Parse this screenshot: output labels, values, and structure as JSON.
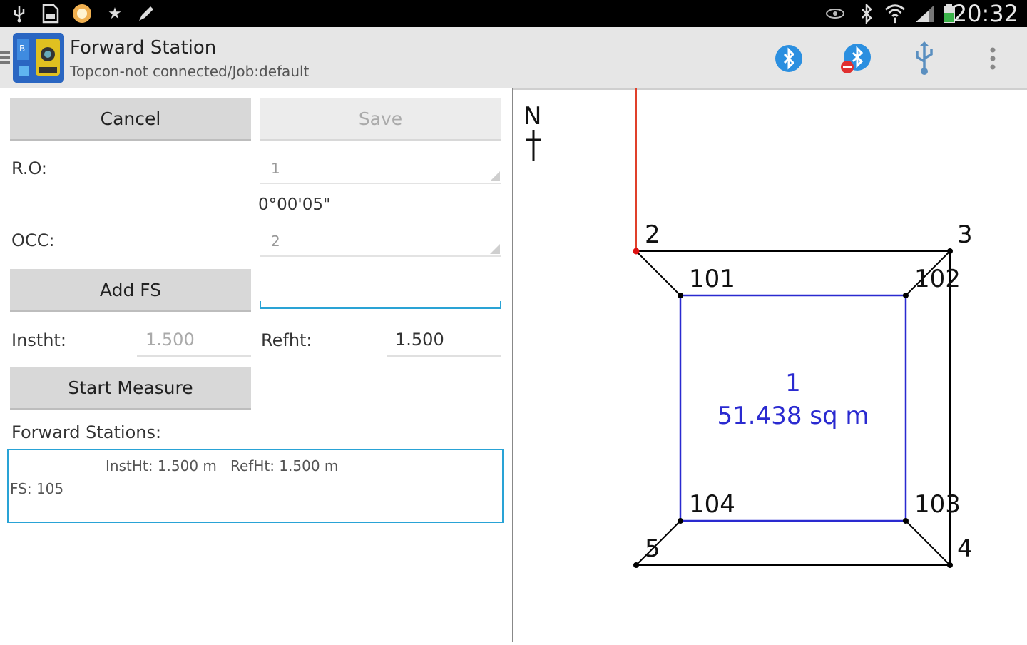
{
  "status_bar": {
    "time": "20:32",
    "left_icons": [
      "usb-icon",
      "sd-card-icon",
      "app-notification-icon",
      "star-icon",
      "pencil-icon"
    ],
    "right_icons": [
      "eye-icon",
      "bluetooth-icon",
      "wifi-icon",
      "signal-icon",
      "battery-icon"
    ]
  },
  "action_bar": {
    "title": "Forward Station",
    "subtitle": "Topcon-not connected/Job:default",
    "actions": [
      "bluetooth-connect-icon",
      "bluetooth-disconnect-icon",
      "usb-icon",
      "overflow-menu-icon"
    ]
  },
  "form": {
    "cancel_label": "Cancel",
    "save_label": "Save",
    "ro_label": "R.O:",
    "ro_value": "1",
    "ro_angle": "0°00'05\"",
    "occ_label": "OCC:",
    "occ_value": "2",
    "add_fs_label": "Add FS",
    "add_fs_input": "",
    "instht_label": "Instht:",
    "instht_value": "1.500",
    "refht_label": "Refht:",
    "refht_value": "1.500",
    "start_measure_label": "Start Measure",
    "forward_stations_label": "Forward Stations:",
    "list": {
      "header": "InstHt: 1.500 m   RefHt: 1.500 m",
      "items": [
        "FS: 105"
      ]
    }
  },
  "map": {
    "north_label": "N",
    "points": [
      "2",
      "3",
      "101",
      "102",
      "103",
      "104",
      "5",
      "4"
    ],
    "area_id": "1",
    "area_label": "51.438 sq m",
    "colors": {
      "outer": "#000000",
      "inner": "#2a2ad0",
      "backsight": "#e0402a"
    }
  }
}
